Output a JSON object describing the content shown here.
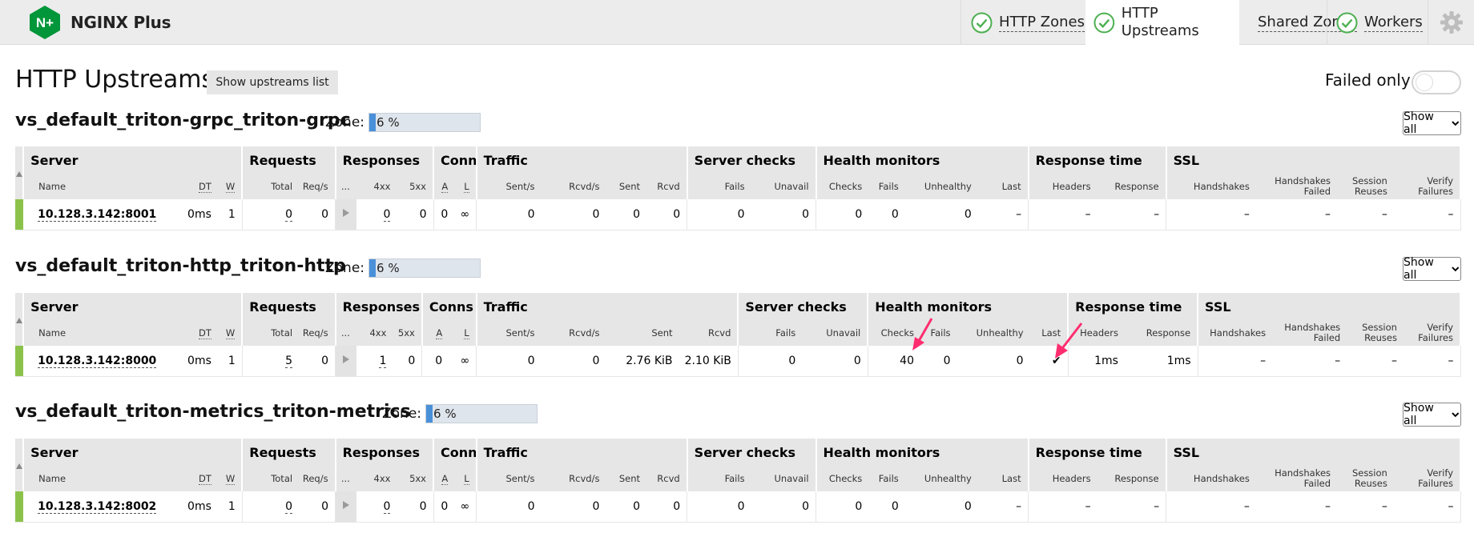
{
  "app": {
    "name": "NGINX Plus",
    "logo_letters": "N+"
  },
  "nav": {
    "tabs": [
      {
        "label": "HTTP Zones",
        "status": "ok",
        "active": false
      },
      {
        "label": "HTTP Upstreams",
        "status": "ok",
        "active": true
      },
      {
        "label": "Shared Zones",
        "status": "",
        "active": false
      },
      {
        "label": "Workers",
        "status": "ok",
        "active": false
      }
    ],
    "settings_icon": "gear-icon"
  },
  "page": {
    "title": "HTTP Upstreams",
    "show_list_label": "Show upstreams list",
    "failed_only_label": "Failed only",
    "failed_only_on": false
  },
  "headers": {
    "groups": {
      "server": "Server",
      "requests": "Requests",
      "responses": "Responses",
      "conns": "Conns",
      "traffic": "Traffic",
      "server_checks": "Server checks",
      "health_monitors": "Health monitors",
      "response_time": "Response time",
      "ssl": "SSL"
    },
    "sub": {
      "name": "Name",
      "dt": "DT",
      "w": "W",
      "total": "Total",
      "reqs": "Req/s",
      "more": "...",
      "r4xx": "4xx",
      "r5xx": "5xx",
      "a": "A",
      "l": "L",
      "sent_s": "Sent/s",
      "rcvd_s": "Rcvd/s",
      "sent": "Sent",
      "rcvd": "Rcvd",
      "fails": "Fails",
      "unavail": "Unavail",
      "checks": "Checks",
      "hm_fails": "Fails",
      "unhealthy": "Unhealthy",
      "last": "Last",
      "headers": "Headers",
      "response": "Response",
      "handshakes": "Handshakes",
      "hs_failed_1": "Handshakes",
      "hs_failed_2": "Failed",
      "sess_1": "Session",
      "sess_2": "Reuses",
      "verify_1": "Verify",
      "verify_2": "Failures"
    }
  },
  "upstreams": [
    {
      "name": "vs_default_triton-grpc_triton-grpc",
      "zone_label": "Zone:",
      "zone_usage": "6 %",
      "zone_fraction": 0.06,
      "filter": "Show all",
      "row": {
        "name": "10.128.3.142:8001",
        "dt": "0ms",
        "w": "1",
        "total": "0",
        "reqs": "0",
        "r4xx": "0",
        "r5xx": "0",
        "a": "0",
        "l": "∞",
        "sent_s": "0",
        "rcvd_s": "0",
        "sent": "0",
        "rcvd": "0",
        "fails": "0",
        "unavail": "0",
        "checks": "0",
        "hm_fails": "0",
        "unhealthy": "0",
        "last": "–",
        "headers": "–",
        "response": "–",
        "handshakes": "–",
        "hs_failed": "–",
        "sess": "–",
        "verify": "–"
      }
    },
    {
      "name": "vs_default_triton-http_triton-http",
      "zone_label": "Zone:",
      "zone_usage": "6 %",
      "zone_fraction": 0.06,
      "filter": "Show all",
      "row": {
        "name": "10.128.3.142:8000",
        "dt": "0ms",
        "w": "1",
        "total": "5",
        "reqs": "0",
        "r4xx": "1",
        "r5xx": "0",
        "a": "0",
        "l": "∞",
        "sent_s": "0",
        "rcvd_s": "0",
        "sent": "2.76 KiB",
        "rcvd": "2.10 KiB",
        "fails": "0",
        "unavail": "0",
        "checks": "40",
        "hm_fails": "0",
        "unhealthy": "0",
        "last": "✔",
        "headers": "1ms",
        "response": "1ms",
        "handshakes": "–",
        "hs_failed": "–",
        "sess": "–",
        "verify": "–"
      }
    },
    {
      "name": "vs_default_triton-metrics_triton-metrics",
      "zone_label": "Zone:",
      "zone_usage": "6 %",
      "zone_fraction": 0.06,
      "filter": "Show all",
      "row": {
        "name": "10.128.3.142:8002",
        "dt": "0ms",
        "w": "1",
        "total": "0",
        "reqs": "0",
        "r4xx": "0",
        "r5xx": "0",
        "a": "0",
        "l": "∞",
        "sent_s": "0",
        "rcvd_s": "0",
        "sent": "0",
        "rcvd": "0",
        "fails": "0",
        "unavail": "0",
        "checks": "0",
        "hm_fails": "0",
        "unhealthy": "0",
        "last": "–",
        "headers": "–",
        "response": "–",
        "handshakes": "–",
        "hs_failed": "–",
        "sess": "–",
        "verify": "–"
      }
    }
  ],
  "colors": {
    "brand_green": "#009639",
    "ok_green": "#4caf50",
    "server_up": "#8bc34a",
    "zone_fill": "#4a90d9",
    "annotation_arrow": "#ff2d6f"
  }
}
